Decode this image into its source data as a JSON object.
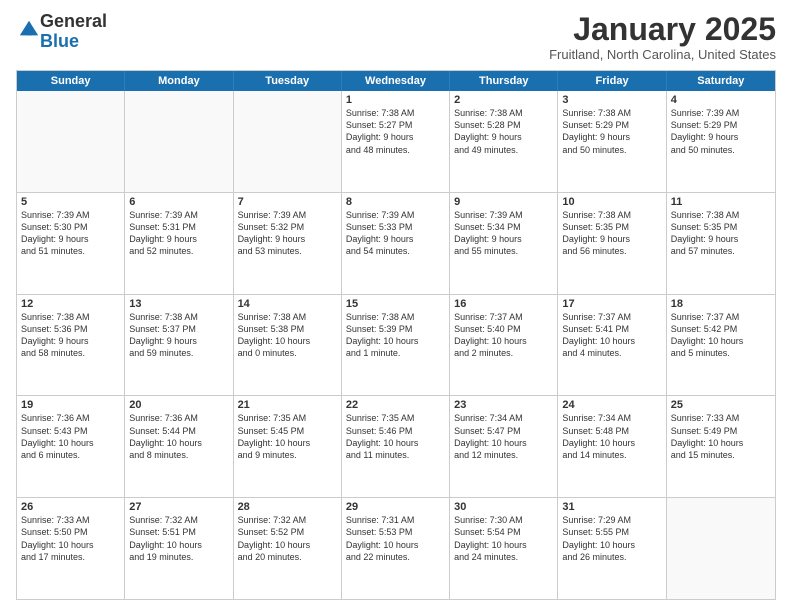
{
  "logo": {
    "general": "General",
    "blue": "Blue"
  },
  "title": "January 2025",
  "location": "Fruitland, North Carolina, United States",
  "days_of_week": [
    "Sunday",
    "Monday",
    "Tuesday",
    "Wednesday",
    "Thursday",
    "Friday",
    "Saturday"
  ],
  "weeks": [
    [
      {
        "day": "",
        "content": ""
      },
      {
        "day": "",
        "content": ""
      },
      {
        "day": "",
        "content": ""
      },
      {
        "day": "1",
        "content": "Sunrise: 7:38 AM\nSunset: 5:27 PM\nDaylight: 9 hours\nand 48 minutes."
      },
      {
        "day": "2",
        "content": "Sunrise: 7:38 AM\nSunset: 5:28 PM\nDaylight: 9 hours\nand 49 minutes."
      },
      {
        "day": "3",
        "content": "Sunrise: 7:38 AM\nSunset: 5:29 PM\nDaylight: 9 hours\nand 50 minutes."
      },
      {
        "day": "4",
        "content": "Sunrise: 7:39 AM\nSunset: 5:29 PM\nDaylight: 9 hours\nand 50 minutes."
      }
    ],
    [
      {
        "day": "5",
        "content": "Sunrise: 7:39 AM\nSunset: 5:30 PM\nDaylight: 9 hours\nand 51 minutes."
      },
      {
        "day": "6",
        "content": "Sunrise: 7:39 AM\nSunset: 5:31 PM\nDaylight: 9 hours\nand 52 minutes."
      },
      {
        "day": "7",
        "content": "Sunrise: 7:39 AM\nSunset: 5:32 PM\nDaylight: 9 hours\nand 53 minutes."
      },
      {
        "day": "8",
        "content": "Sunrise: 7:39 AM\nSunset: 5:33 PM\nDaylight: 9 hours\nand 54 minutes."
      },
      {
        "day": "9",
        "content": "Sunrise: 7:39 AM\nSunset: 5:34 PM\nDaylight: 9 hours\nand 55 minutes."
      },
      {
        "day": "10",
        "content": "Sunrise: 7:38 AM\nSunset: 5:35 PM\nDaylight: 9 hours\nand 56 minutes."
      },
      {
        "day": "11",
        "content": "Sunrise: 7:38 AM\nSunset: 5:35 PM\nDaylight: 9 hours\nand 57 minutes."
      }
    ],
    [
      {
        "day": "12",
        "content": "Sunrise: 7:38 AM\nSunset: 5:36 PM\nDaylight: 9 hours\nand 58 minutes."
      },
      {
        "day": "13",
        "content": "Sunrise: 7:38 AM\nSunset: 5:37 PM\nDaylight: 9 hours\nand 59 minutes."
      },
      {
        "day": "14",
        "content": "Sunrise: 7:38 AM\nSunset: 5:38 PM\nDaylight: 10 hours\nand 0 minutes."
      },
      {
        "day": "15",
        "content": "Sunrise: 7:38 AM\nSunset: 5:39 PM\nDaylight: 10 hours\nand 1 minute."
      },
      {
        "day": "16",
        "content": "Sunrise: 7:37 AM\nSunset: 5:40 PM\nDaylight: 10 hours\nand 2 minutes."
      },
      {
        "day": "17",
        "content": "Sunrise: 7:37 AM\nSunset: 5:41 PM\nDaylight: 10 hours\nand 4 minutes."
      },
      {
        "day": "18",
        "content": "Sunrise: 7:37 AM\nSunset: 5:42 PM\nDaylight: 10 hours\nand 5 minutes."
      }
    ],
    [
      {
        "day": "19",
        "content": "Sunrise: 7:36 AM\nSunset: 5:43 PM\nDaylight: 10 hours\nand 6 minutes."
      },
      {
        "day": "20",
        "content": "Sunrise: 7:36 AM\nSunset: 5:44 PM\nDaylight: 10 hours\nand 8 minutes."
      },
      {
        "day": "21",
        "content": "Sunrise: 7:35 AM\nSunset: 5:45 PM\nDaylight: 10 hours\nand 9 minutes."
      },
      {
        "day": "22",
        "content": "Sunrise: 7:35 AM\nSunset: 5:46 PM\nDaylight: 10 hours\nand 11 minutes."
      },
      {
        "day": "23",
        "content": "Sunrise: 7:34 AM\nSunset: 5:47 PM\nDaylight: 10 hours\nand 12 minutes."
      },
      {
        "day": "24",
        "content": "Sunrise: 7:34 AM\nSunset: 5:48 PM\nDaylight: 10 hours\nand 14 minutes."
      },
      {
        "day": "25",
        "content": "Sunrise: 7:33 AM\nSunset: 5:49 PM\nDaylight: 10 hours\nand 15 minutes."
      }
    ],
    [
      {
        "day": "26",
        "content": "Sunrise: 7:33 AM\nSunset: 5:50 PM\nDaylight: 10 hours\nand 17 minutes."
      },
      {
        "day": "27",
        "content": "Sunrise: 7:32 AM\nSunset: 5:51 PM\nDaylight: 10 hours\nand 19 minutes."
      },
      {
        "day": "28",
        "content": "Sunrise: 7:32 AM\nSunset: 5:52 PM\nDaylight: 10 hours\nand 20 minutes."
      },
      {
        "day": "29",
        "content": "Sunrise: 7:31 AM\nSunset: 5:53 PM\nDaylight: 10 hours\nand 22 minutes."
      },
      {
        "day": "30",
        "content": "Sunrise: 7:30 AM\nSunset: 5:54 PM\nDaylight: 10 hours\nand 24 minutes."
      },
      {
        "day": "31",
        "content": "Sunrise: 7:29 AM\nSunset: 5:55 PM\nDaylight: 10 hours\nand 26 minutes."
      },
      {
        "day": "",
        "content": ""
      }
    ]
  ]
}
